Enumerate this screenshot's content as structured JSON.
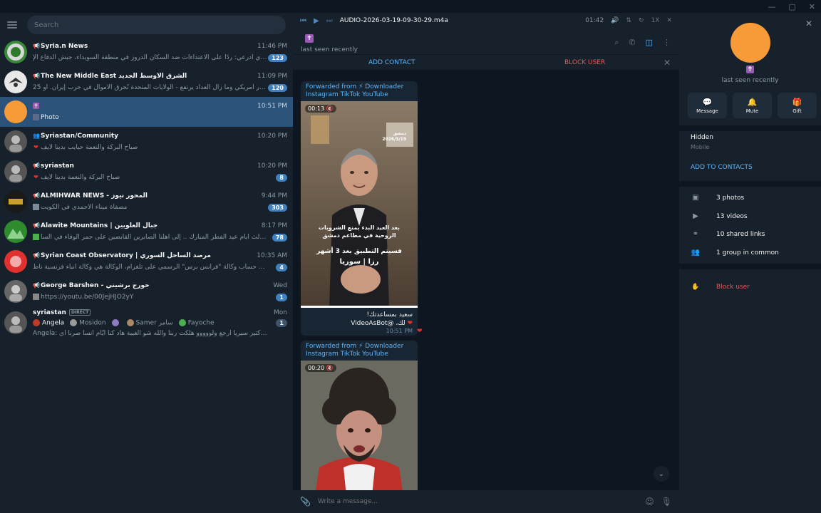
{
  "search": {
    "placeholder": "Search"
  },
  "chats": [
    {
      "name": "Syria.n News",
      "time": "11:46 PM",
      "msg": "الأيخاي ادرعي: ردًا على الاعتداءات ضد السكان الدروز في منطقة السويداء، جيش الدفاع الإ",
      "badge": "123",
      "avatar_color": "#3a8a3a"
    },
    {
      "name": "The New Middle East الشرق الأوسط الجديد",
      "time": "11:09 PM",
      "msg": "25 مليار دولار أمريكي وما زال العداد يرتفع - الولايات المتحدة تُحرق الأموال في حرب إيران. أو...",
      "badge": "120",
      "avatar_color": "#e8e8e8"
    },
    {
      "name": "",
      "time": "10:51 PM",
      "msg": "Photo",
      "badge": "",
      "avatar_color": "#f79a38"
    },
    {
      "name": "Syriastan/Community",
      "time": "10:20 PM",
      "msg": "صباح البركة والنعمة حبايب بدينا لايف",
      "badge": "",
      "avatar_color": "#555555"
    },
    {
      "name": "syriastan",
      "time": "10:20 PM",
      "msg": "صباح البركة والنعمة بدينا لايف",
      "badge": "8",
      "avatar_color": "#555555"
    },
    {
      "name": "ALMIHWAR NEWS - المحور نيوز",
      "time": "9:44 PM",
      "msg": "مصفاة ميناء الأحمدي في الكويت",
      "badge": "303",
      "avatar_color": "#1a1a1a"
    },
    {
      "name": "Alawite Mountains | جبال العلويين",
      "time": "8:17 PM",
      "msg": "في ثالث ايام عيد الفطر المبارك .. إلى أهلنا الصابرين القابضين على جمر الوفاء في السا...",
      "badge": "78",
      "avatar_color": "#2e8b2e"
    },
    {
      "name": "Syrian Coast Observatory | مرصد الساحل السوري",
      "time": "10:35 AM",
      "msg": "ندعوكم للانضمام إلى حساب وكالة \"فرانس برس\" الرسمي على تلغرام، الوكالة هي وكالة أنباء فرنسية ناط...",
      "badge": "4",
      "avatar_color": "#e03030"
    },
    {
      "name": "George Barshen - جورج برشيني",
      "time": "Wed",
      "msg": "https://youtu.be/00JejHJO2yY",
      "badge": "1",
      "avatar_color": "#666666"
    },
    {
      "name": "syriastan",
      "time": "Mon",
      "msg": "Angela: اشتقنا لك كتير سيريا ارجع ولووووو هلكت ربنا والله شو الغيبة هاد كنا أيّام انسا صرنا أي...",
      "badge": "1",
      "avatar_color": "#555555",
      "tag": "DIRECT"
    }
  ],
  "chat9_names": [
    "Angela",
    "Mosidon",
    "",
    "Samer سامر",
    "Fayoche"
  ],
  "player": {
    "title": "AUDIO-2026-03-19-09-30-29.m4a",
    "time": "01:42",
    "speed": "1X"
  },
  "header": {
    "status": "last seen recently"
  },
  "actionbar": {
    "add_contact": "ADD CONTACT",
    "block_user": "BLOCK USER"
  },
  "messages": [
    {
      "fwd_line1": "Forwarded from ⚡ Downloader",
      "fwd_line2": "Instagram TikTok YouTube",
      "duration": "00:13",
      "caption1": "سعيد بمساعدتك!",
      "caption2": "لك، @VideoAsBot",
      "time": "10:51 PM",
      "progress": 1.0,
      "overlay1": "بعد العيد البدء بمنع الشروبات",
      "overlay2": "الروحية في مطاعم دمشق",
      "overlay3": "فسيتم التطبيق بعد 3 أشهر",
      "overlay4": "رزا | سوريا",
      "overlay5": "دمشق",
      "overlay6": "2026/3/19"
    },
    {
      "fwd_line1": "Forwarded from ⚡ Downloader",
      "fwd_line2": "Instagram TikTok YouTube",
      "duration": "00:20"
    }
  ],
  "composer": {
    "placeholder": "Write a message..."
  },
  "profile": {
    "status": "last seen recently",
    "actions": [
      {
        "label": "Message",
        "icon": "chat-bubble-icon"
      },
      {
        "label": "Mute",
        "icon": "bell-icon"
      },
      {
        "label": "Gift",
        "icon": "gift-icon"
      }
    ],
    "phone_label": "Hidden",
    "phone_sub": "Mobile",
    "add_contacts": "ADD TO CONTACTS",
    "media": [
      {
        "label": "3 photos",
        "icon": "photo-icon"
      },
      {
        "label": "13 videos",
        "icon": "video-icon"
      },
      {
        "label": "10 shared links",
        "icon": "link-icon"
      },
      {
        "label": "1 group in common",
        "icon": "group-icon"
      }
    ],
    "block": "Block user"
  },
  "colors": {
    "accent": "#5eb5f7",
    "active": "#2b5278",
    "danger": "#e05a5a",
    "badge": "#3f80bd",
    "avatar": "#f79a38"
  }
}
